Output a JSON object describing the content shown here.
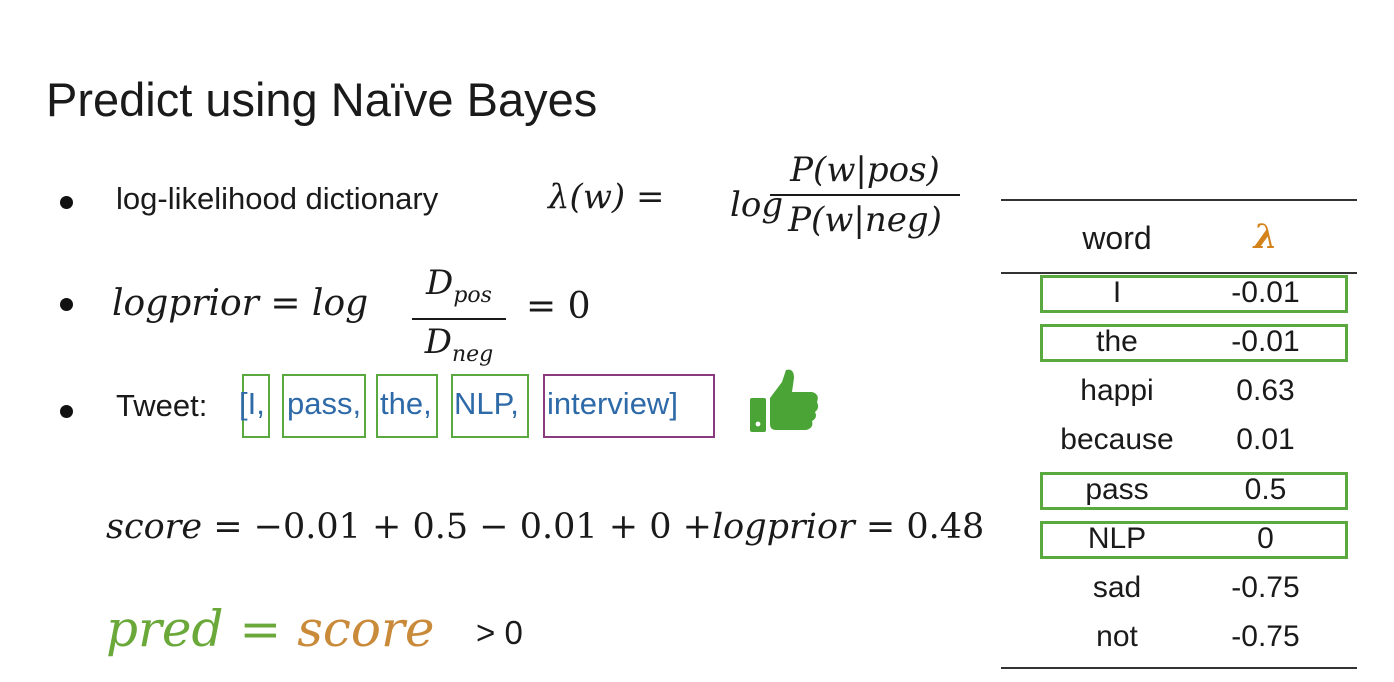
{
  "title": "Predict using Naïve Bayes",
  "bullet1": {
    "label": "log-likelihood dictionary",
    "lhs": "λ(w) =",
    "log": "log",
    "numerator": "P(w|pos)",
    "denominator": "P(w|neg)"
  },
  "bullet2": {
    "lhs": "logprior = log",
    "num_base": "D",
    "num_sub": "pos",
    "den_base": "D",
    "den_sub": "neg",
    "rhs": "= 0"
  },
  "bullet3": {
    "label": "Tweet: ",
    "tokens": [
      "[I,",
      "pass,",
      "the,",
      "NLP,",
      "interview]"
    ]
  },
  "score_equation": {
    "lhs": "score",
    "middle": " = −0.01 + 0.5 − 0.01 + 0 +",
    "logprior": "logprior",
    "rhs": " = 0.48"
  },
  "prediction": {
    "pred": "pred",
    "equals": " = ",
    "score": "score",
    "comparison": "> 0"
  },
  "table": {
    "header_word": "word",
    "header_lambda": "λ",
    "rows": [
      {
        "word": "I",
        "value": "-0.01"
      },
      {
        "word": "the",
        "value": "-0.01"
      },
      {
        "word": "happi",
        "value": "0.63"
      },
      {
        "word": "because",
        "value": "0.01"
      },
      {
        "word": "pass",
        "value": "0.5"
      },
      {
        "word": "NLP",
        "value": "0"
      },
      {
        "word": "sad",
        "value": "-0.75"
      },
      {
        "word": "not",
        "value": "-0.75"
      }
    ]
  },
  "colors": {
    "highlight_green": "#5aa840",
    "highlight_purple": "#8a3a7e",
    "token_blue": "#2e6aa8",
    "lambda_orange": "#d4831a",
    "pred_green": "#6aa83a",
    "score_orange": "#c98a3a"
  },
  "icons": [
    "thumbs-up-icon"
  ]
}
